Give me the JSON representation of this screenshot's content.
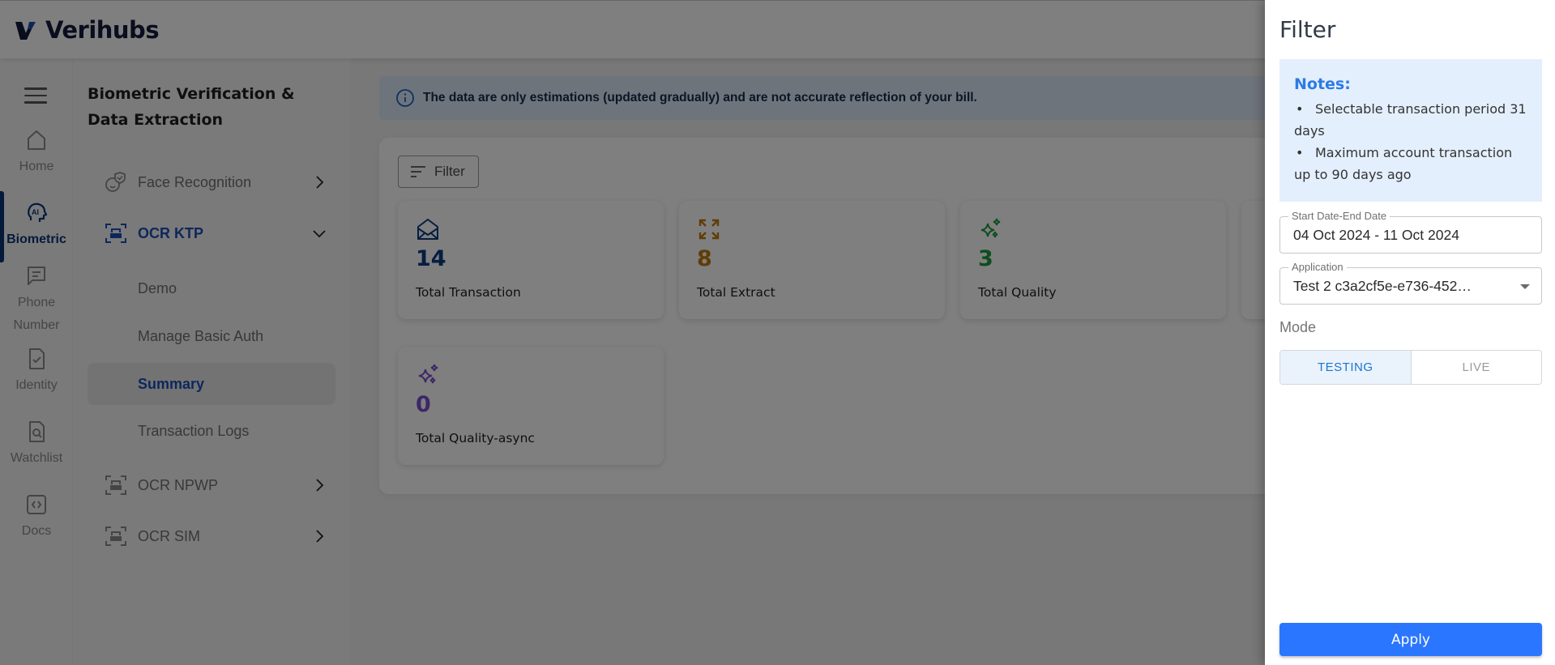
{
  "header": {
    "brand": "Verihubs"
  },
  "rail": {
    "items": [
      {
        "label": "Home",
        "icon": "home-icon"
      },
      {
        "label": "Biometric",
        "icon": "ai-head-icon",
        "active": true
      },
      {
        "label": "Phone Number",
        "icon": "message-icon"
      },
      {
        "label": "Identity",
        "icon": "document-check-icon"
      },
      {
        "label": "Watchlist",
        "icon": "document-search-icon"
      },
      {
        "label": "Docs",
        "icon": "code-icon"
      }
    ],
    "phone_line1": "Phone",
    "phone_line2": "Number"
  },
  "subnav": {
    "title": "Biometric Verification & Data Extraction",
    "groups": [
      {
        "label": "Face Recognition",
        "icon": "face-shield-icon",
        "expanded": false
      },
      {
        "label": "OCR KTP",
        "icon": "scan-card-icon",
        "expanded": true
      },
      {
        "label": "OCR NPWP",
        "icon": "scan-card-icon",
        "expanded": false
      },
      {
        "label": "OCR SIM",
        "icon": "scan-card-icon",
        "expanded": false
      }
    ],
    "ocr_ktp_items": [
      {
        "label": "Demo"
      },
      {
        "label": "Manage Basic Auth"
      },
      {
        "label": "Summary",
        "active": true
      },
      {
        "label": "Transaction Logs"
      }
    ]
  },
  "main": {
    "notice": "The data are only estimations (updated gradually) and are not accurate reflection of your bill.",
    "filter_button": "Filter",
    "cards": [
      {
        "value": "14",
        "label": "Total Transaction",
        "icon": "envelope-open-icon",
        "color": "#0d3a80"
      },
      {
        "value": "8",
        "label": "Total Extract",
        "icon": "expand-arrows-icon",
        "color": "#c07a0a"
      },
      {
        "value": "3",
        "label": "Total Quality",
        "icon": "sparkles-icon",
        "color": "#1e9a3e"
      },
      {
        "value": "0",
        "label": "Total Quality-async",
        "icon": "sparkles-icon",
        "color": "#7b4fd0"
      }
    ]
  },
  "drawer": {
    "title": "Filter",
    "notes_title": "Notes:",
    "notes": [
      "Selectable transaction period 31 days",
      "Maximum account transaction up to 90 days ago"
    ],
    "date_label": "Start Date-End Date",
    "date_value": "04 Oct 2024 - 11 Oct 2024",
    "application_label": "Application",
    "application_value": "Test 2 c3a2cf5e-e736-452…",
    "mode_label": "Mode",
    "mode_options": [
      "TESTING",
      "LIVE"
    ],
    "mode_selected": "TESTING",
    "apply_label": "Apply",
    "accent": "#2a76ff"
  }
}
